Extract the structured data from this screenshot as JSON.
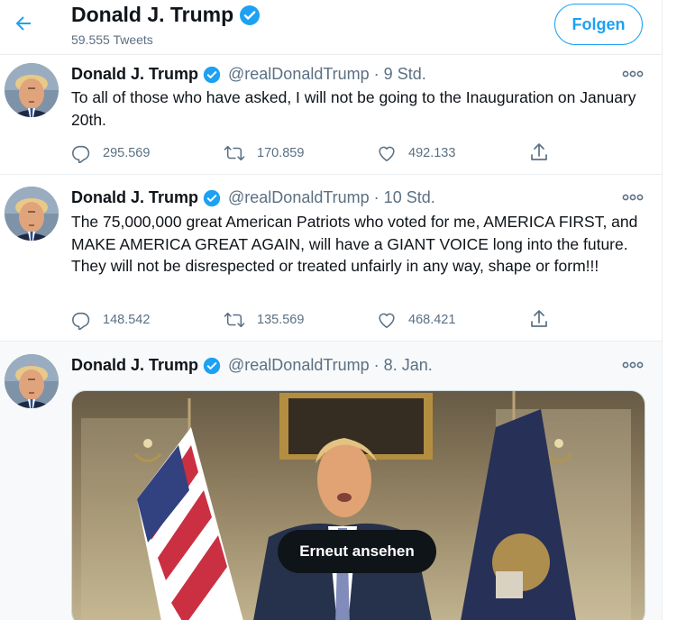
{
  "header": {
    "name": "Donald J. Trump",
    "tweet_count": "59.555 Tweets",
    "follow_label": "Folgen"
  },
  "tweets": [
    {
      "name": "Donald J. Trump",
      "meta": "@realDonaldTrump · 9 Std.",
      "text": "To all of those who have asked, I will not be going to the Inauguration on January 20th.",
      "replies": "295.569",
      "retweets": "170.859",
      "likes": "492.133"
    },
    {
      "name": "Donald J. Trump",
      "meta": "@realDonaldTrump · 10 Std.",
      "text": "The 75,000,000 great American Patriots who voted for me, AMERICA FIRST, and MAKE AMERICA GREAT AGAIN, will have a GIANT VOICE long into the future. They will not be disrespected or treated unfairly in any way, shape or form!!!",
      "replies": "148.542",
      "retweets": "135.569",
      "likes": "468.421"
    },
    {
      "name": "Donald J. Trump",
      "meta": "@realDonaldTrump · 8. Jan.",
      "replay_label": "Erneut ansehen"
    }
  ],
  "colors": {
    "accent": "#1da1f2",
    "text": "#0f1419",
    "secondary": "#5b7083",
    "divider": "#ebeef0"
  },
  "icons": [
    "back-arrow-icon",
    "verified-badge-icon",
    "more-icon",
    "reply-icon",
    "retweet-icon",
    "like-icon",
    "share-icon"
  ]
}
